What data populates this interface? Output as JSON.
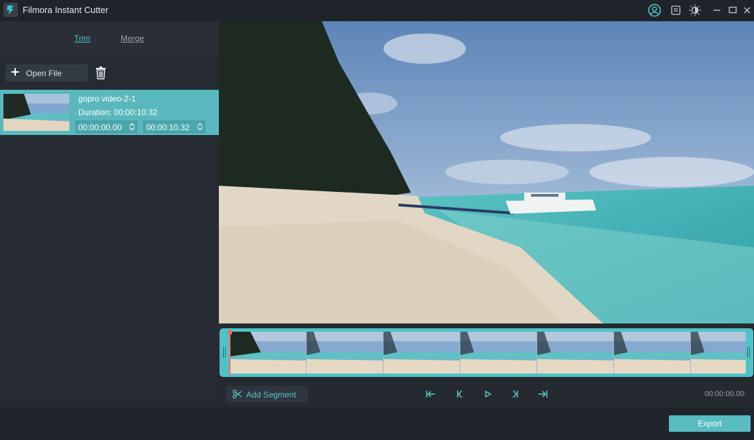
{
  "window": {
    "title": "Filmora Instant Cutter"
  },
  "titlebar_icons": [
    "account-icon",
    "feedback-icon",
    "brightness-icon",
    "minimize-icon",
    "maximize-icon",
    "close-icon"
  ],
  "tabs": [
    {
      "label": "Trim",
      "active": true
    },
    {
      "label": "Merge",
      "active": false
    }
  ],
  "toolbar": {
    "open_file_label": "Open File"
  },
  "clip": {
    "name": "gopro video-2-1",
    "duration": "Duration: 00:00:10.32",
    "start_time": "00:00:00.00",
    "end_time": "00:00:10.32"
  },
  "timeline": {
    "add_segment_label": "Add Segment",
    "timecode": "00:00:00.00",
    "frame_count": 7
  },
  "footer": {
    "export_label": "Export"
  },
  "colors": {
    "accent": "#59bcc1",
    "background": "#232830",
    "playhead": "#ff6a5a"
  }
}
